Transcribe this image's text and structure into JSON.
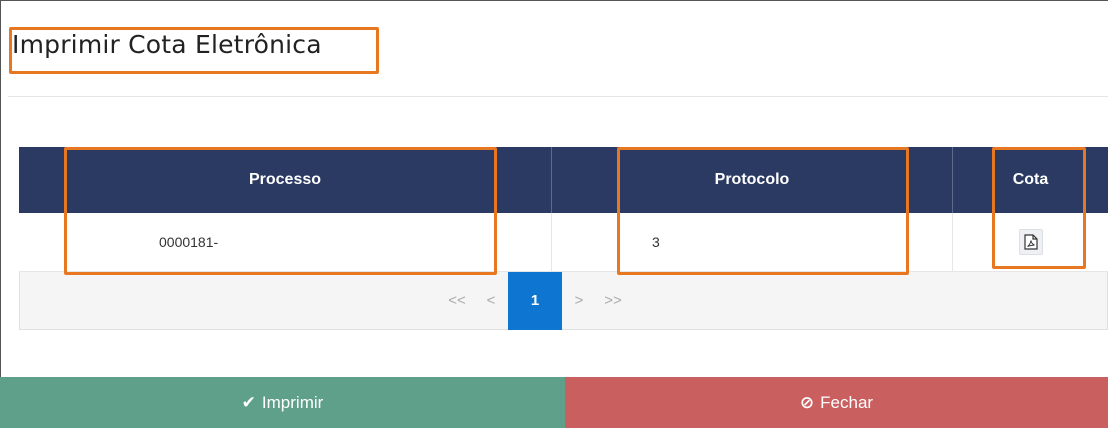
{
  "dialog": {
    "title": "Imprimir Cota Eletrônica"
  },
  "table": {
    "columns": [
      "Processo",
      "Protocolo",
      "Cota"
    ],
    "rows": [
      {
        "processo": "0000181-",
        "protocolo": "3",
        "cota_icon": "pdf-icon"
      }
    ]
  },
  "pagination": {
    "first": "<<",
    "prev": "<",
    "current": "1",
    "next": ">",
    "last": ">>"
  },
  "footer": {
    "print_label": "Imprimir",
    "close_label": "Fechar"
  },
  "colors": {
    "header_bg": "#2b3a63",
    "highlight": "#e87722",
    "print_bg": "#5fa08b",
    "close_bg": "#c95f5f",
    "page_active": "#0e75d0"
  }
}
